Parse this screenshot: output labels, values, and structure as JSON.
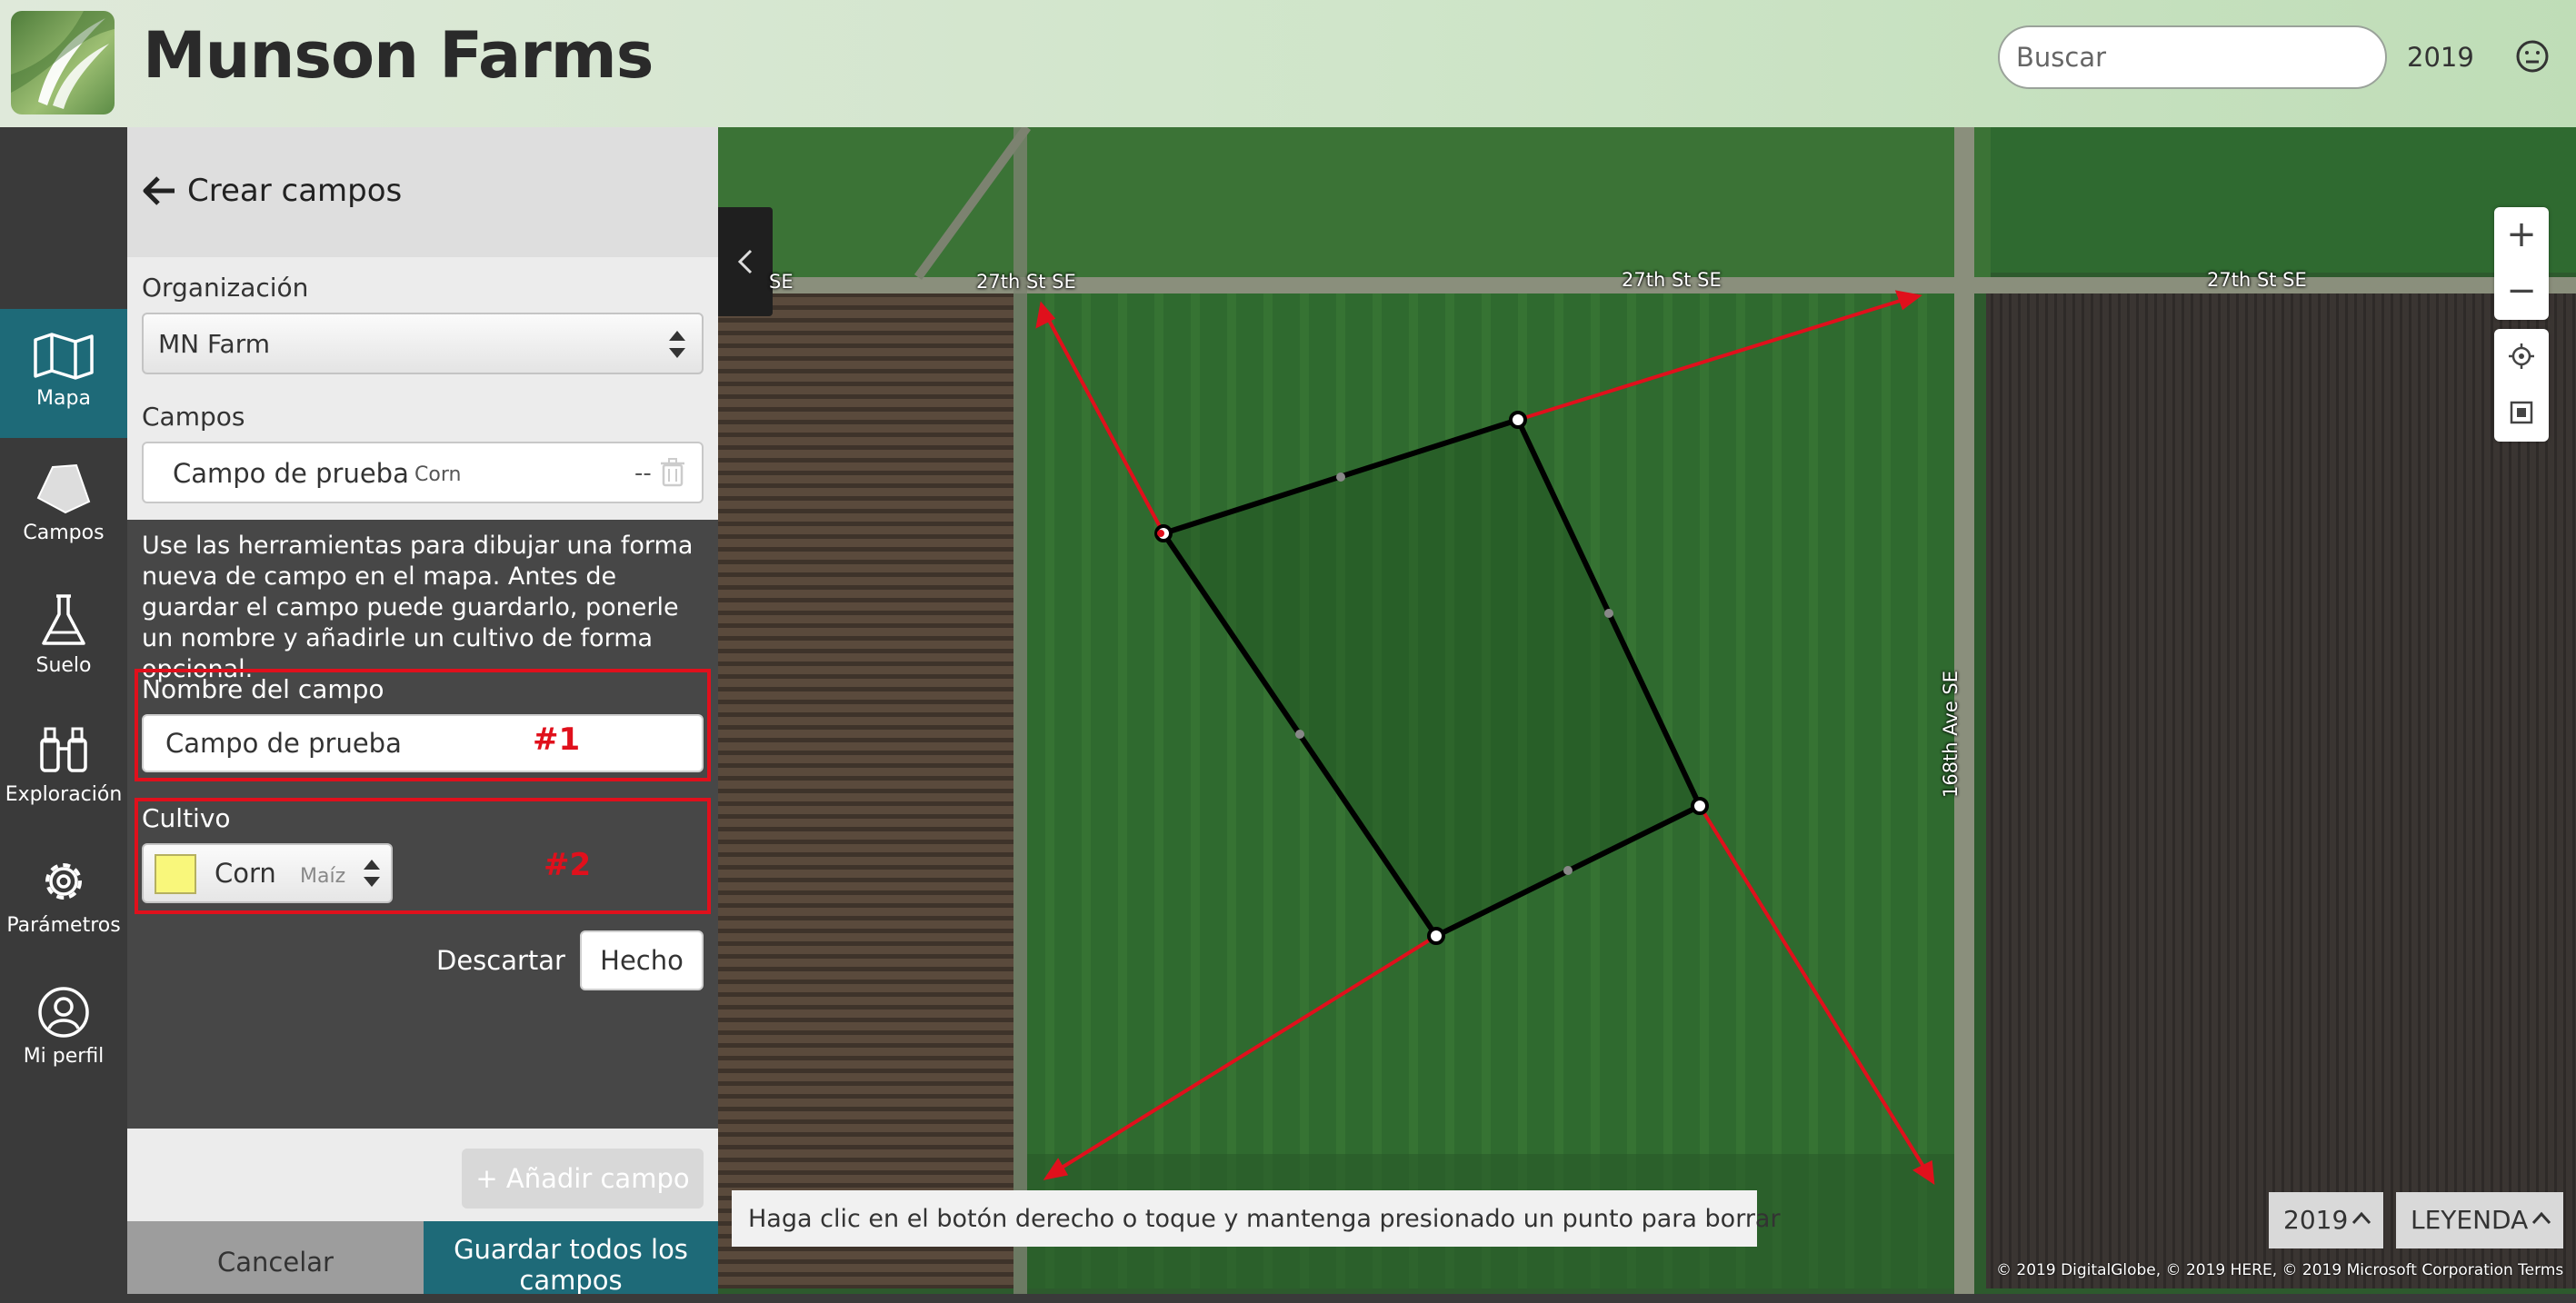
{
  "header": {
    "app_title": "Munson Farms",
    "search_placeholder": "Buscar",
    "year": "2019"
  },
  "nav": {
    "items": [
      {
        "label": "Mapa",
        "icon": "map-icon",
        "active": true
      },
      {
        "label": "Campos",
        "icon": "field-shape-icon",
        "active": false
      },
      {
        "label": "Suelo",
        "icon": "flask-icon",
        "active": false
      },
      {
        "label": "Exploración",
        "icon": "binoculars-icon",
        "active": false
      },
      {
        "label": "Parámetros",
        "icon": "gear-icon",
        "active": false
      },
      {
        "label": "Mi perfil",
        "icon": "user-icon",
        "active": false
      }
    ]
  },
  "panel": {
    "title": "Crear campos",
    "org_label": "Organización",
    "org_value": "MN Farm",
    "fields_label": "Campos",
    "field_item": {
      "name": "Campo de prueba",
      "crop": "Corn",
      "area": "--"
    },
    "instructions": "Use las herramientas para dibujar una forma nueva de campo en el mapa. Antes de guardar el campo puede guardarlo, ponerle un nombre y añadirle un cultivo de forma opcional.",
    "name_label": "Nombre del campo",
    "name_value": "Campo de prueba",
    "marker_1": "#1",
    "crop_label": "Cultivo",
    "crop_value": "Corn",
    "crop_value_es": "Maíz",
    "marker_2": "#2",
    "discard_label": "Descartar",
    "done_label": "Hecho",
    "add_field_label": "+ Añadir campo",
    "cancel_label": "Cancelar",
    "save_all_label": "Guardar todos los campos"
  },
  "map": {
    "road_labels": [
      "SE",
      "27th St SE",
      "27th St SE",
      "27th St SE",
      "168th Ave SE"
    ],
    "zoom_in": "+",
    "zoom_out": "−",
    "help_text": "Haga clic en el botón derecho o toque y mantenga presionado un punto para borrar",
    "year_toggle": "2019",
    "legend_toggle": "LEYENDA",
    "attribution": "© 2019 DigitalGlobe, © 2019 HERE, © 2019 Microsoft Corporation  Terms",
    "colors": {
      "annotation": "#e0101c",
      "polygon": "#000000",
      "accent": "#1e6a78"
    }
  }
}
